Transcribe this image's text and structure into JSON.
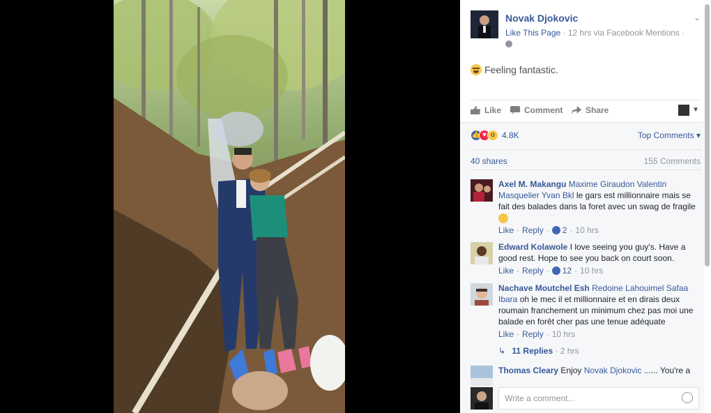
{
  "post": {
    "page_name": "Novak Djokovic",
    "like_page": "Like This Page",
    "meta": "· 12 hrs via Facebook Mentions ·",
    "feeling": "Feeling fantastic.",
    "actions": {
      "like": "Like",
      "comment": "Comment",
      "share": "Share"
    }
  },
  "reactions": {
    "count": "4.8K",
    "top_comments": "Top Comments ▾"
  },
  "stats": {
    "shares": "40 shares",
    "comments": "155 Comments"
  },
  "comments": [
    {
      "author": "Axel M. Makangu",
      "tags": "Maxime Giraudon Valentin Masquelier Yvan Bkl",
      "text": " le gars est millionnaire mais se fait des balades dans la foret avec un swag de fragile ",
      "like": "Like",
      "reply": "Reply",
      "likes": "2",
      "time": "10 hrs"
    },
    {
      "author": "Edward Kolawole",
      "tags": "",
      "text": " I love seeing you guy's. Have a good rest. Hope to see you back on court soon.",
      "like": "Like",
      "reply": "Reply",
      "likes": "12",
      "time": "10 hrs"
    },
    {
      "author": "Nachave Moutchel Esh",
      "tags": "Redoine Lahouimel Safaa Ibara",
      "text": " oh le mec il et millionnaire et en dirais deux roumain franchement un minimum chez pas moi une balade en forêt cher pas une tenue adéquate",
      "like": "Like",
      "reply": "Reply",
      "time": "10 hrs"
    },
    {
      "author": "Thomas Cleary",
      "text_before": " Enjoy ",
      "tags": "Novak Djokovic",
      "text": " ...... You're a"
    }
  ],
  "replies": {
    "label": "11 Replies",
    "time": "· 2 hrs"
  },
  "composer": {
    "placeholder": "Write a comment..."
  },
  "colors": {
    "link": "#365899",
    "muted": "#90949c",
    "panel_bg": "#f6f7f9"
  }
}
